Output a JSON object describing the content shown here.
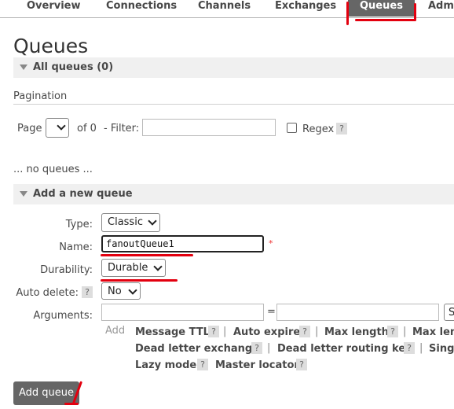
{
  "nav": {
    "tabs": [
      "Overview",
      "Connections",
      "Channels",
      "Exchanges",
      "Queues",
      "Admi"
    ]
  },
  "page_title": "Queues",
  "all_queues": "All queues (0)",
  "pagination": {
    "label": "Pagination",
    "page_label": "Page",
    "page_value": "",
    "of_label": "of 0",
    "filter_label": "- Filter:",
    "filter_value": "",
    "regex_label": "Regex",
    "help": "?"
  },
  "no_queues": "... no queues ...",
  "add_queue": {
    "header": "Add a new queue",
    "type_label": "Type:",
    "type_value": "Classic",
    "name_label": "Name:",
    "name_value": "fanoutQueue1",
    "required_mark": "*",
    "durability_label": "Durability:",
    "durability_value": "Durable",
    "autodelete_label": "Auto delete:",
    "autodelete_value": "No",
    "arguments_label": "Arguments:",
    "equals": "=",
    "type_select_partial": "S",
    "add_label": "Add",
    "args": [
      "Message TTL",
      "Auto expire",
      "Max length",
      "Max len",
      "Dead letter exchange",
      "Dead letter routing key",
      "Singl",
      "Lazy mode",
      "Master locator"
    ],
    "separator": "|",
    "help": "?",
    "submit": "Add queue"
  },
  "colors": {
    "annotation": "#e3000f",
    "active_tab": "#666666",
    "button": "#666666"
  }
}
